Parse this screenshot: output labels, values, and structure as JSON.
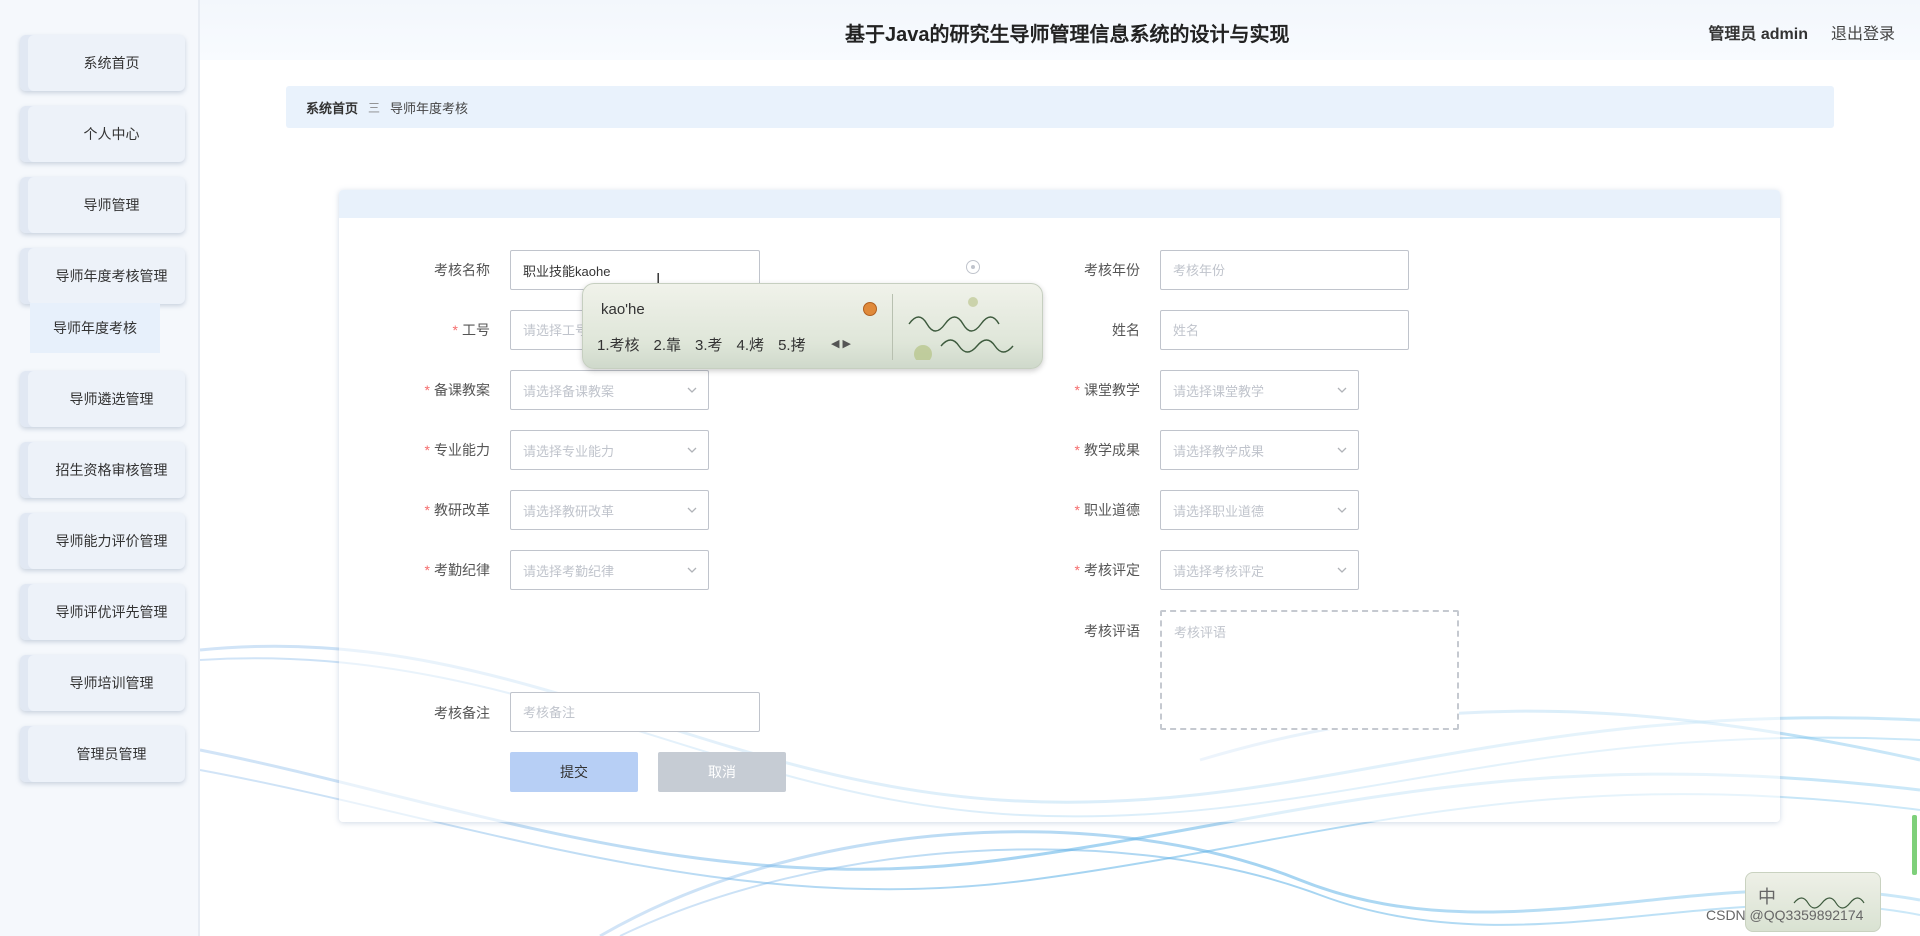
{
  "header": {
    "title": "基于Java的研究生导师管理信息系统的设计与实现",
    "user": "管理员 admin",
    "logout": "退出登录"
  },
  "sidebar": {
    "items": [
      {
        "label": "系统首页"
      },
      {
        "label": "个人中心"
      },
      {
        "label": "导师管理"
      },
      {
        "label": "导师年度考核管理"
      },
      {
        "label": "导师遴选管理"
      },
      {
        "label": "招生资格审核管理"
      },
      {
        "label": "导师能力评价管理"
      },
      {
        "label": "导师评优评先管理"
      },
      {
        "label": "导师培训管理"
      },
      {
        "label": "管理员管理"
      }
    ],
    "submenu": {
      "label": "导师年度考核"
    }
  },
  "breadcrumb": {
    "home": "系统首页",
    "separator": "三",
    "current": "导师年度考核"
  },
  "form": {
    "kaohe_name": {
      "label": "考核名称",
      "value": "职业技能kaohe"
    },
    "kaohe_year": {
      "label": "考核年份",
      "placeholder": "考核年份"
    },
    "gonghao": {
      "label": "工号",
      "placeholder": "请选择工号"
    },
    "xingming": {
      "label": "姓名",
      "placeholder": "姓名"
    },
    "beike": {
      "label": "备课教案",
      "placeholder": "请选择备课教案"
    },
    "ketang": {
      "label": "课堂教学",
      "placeholder": "请选择课堂教学"
    },
    "zhuanye": {
      "label": "专业能力",
      "placeholder": "请选择专业能力"
    },
    "jiaoxue": {
      "label": "教学成果",
      "placeholder": "请选择教学成果"
    },
    "jiaoyan": {
      "label": "教研改革",
      "placeholder": "请选择教研改革"
    },
    "zhiye": {
      "label": "职业道德",
      "placeholder": "请选择职业道德"
    },
    "kaoqin": {
      "label": "考勤纪律",
      "placeholder": "请选择考勤纪律"
    },
    "pingding": {
      "label": "考核评定",
      "placeholder": "请选择考核评定"
    },
    "pingyu": {
      "label": "考核评语",
      "placeholder": "考核评语"
    },
    "beizhu": {
      "label": "考核备注",
      "placeholder": "考核备注"
    },
    "required_mark": "*",
    "submit": "提交",
    "cancel": "取消"
  },
  "ime": {
    "pinyin": "kao'he",
    "candidates": [
      "1.考核",
      "2.靠",
      "3.考",
      "4.烤",
      "5.拷"
    ],
    "tray_label": "中"
  },
  "watermark": "CSDN @QQ3359892174",
  "colors": {
    "accent": "#b7cff5",
    "breadcrumb_bg": "#e9f2fc",
    "required": "#f56c6c"
  }
}
